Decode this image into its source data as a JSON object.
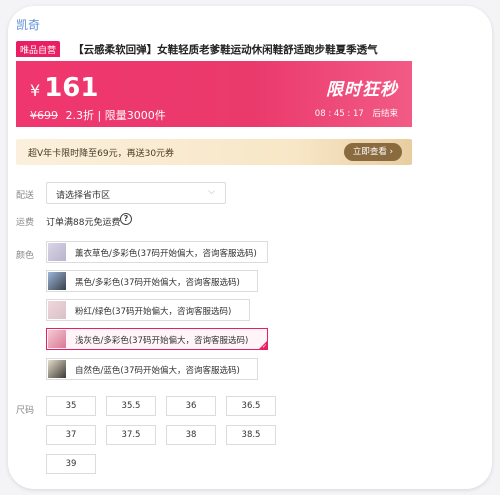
{
  "brand": "凯奇",
  "product": {
    "tag": "唯品自营",
    "title": "【云感柔软回弹】女鞋轻质老爹鞋运动休闲鞋舒适跑步鞋夏季透气"
  },
  "price": {
    "currency": "¥",
    "current": "161",
    "original": "¥699",
    "discount": "2.3折",
    "separator": "|",
    "limit": "限量3000件",
    "flash_title": "限时狂秒",
    "countdown": "08 : 45 : 17",
    "countdown_suffix": "后结束"
  },
  "vip": {
    "text": "超V年卡限时降至69元，再送30元券",
    "button": "立即查看 ›"
  },
  "delivery": {
    "label": "配送",
    "select_value": "请选择省市区",
    "chevron": "⌵"
  },
  "shipping": {
    "label": "运费",
    "text": "订单满88元免运费",
    "help": "?"
  },
  "color": {
    "label": "颜色",
    "options": [
      {
        "name": "薰衣草色/多彩色(37码开始偏大，咨询客服选码)"
      },
      {
        "name": "黑色/多彩色(37码开始偏大，咨询客服选码)"
      },
      {
        "name": "粉红/绿色(37码开始偏大，咨询客服选码)"
      },
      {
        "name": "浅灰色/多彩色(37码开始偏大，咨询客服选码)"
      },
      {
        "name": "自然色/蓝色(37码开始偏大，咨询客服选码)"
      }
    ],
    "selected_index": 3
  },
  "size": {
    "label": "尺码",
    "options": [
      "35",
      "35.5",
      "36",
      "36.5",
      "37",
      "37.5",
      "38",
      "38.5",
      "39"
    ]
  },
  "colors": {
    "accent": "#e91e63",
    "banner": "#f0366e",
    "vip_button": "#8a6b3f"
  }
}
